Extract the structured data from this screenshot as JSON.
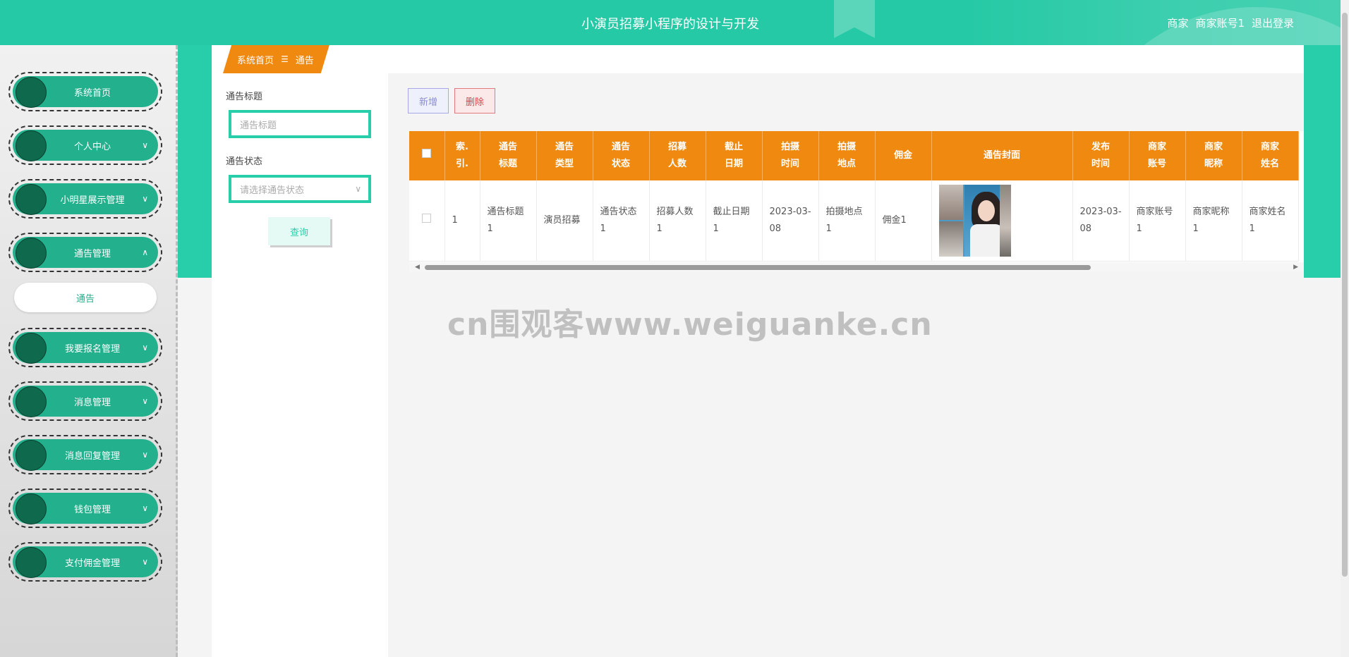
{
  "header": {
    "title": "小演员招募小程序的设计与开发",
    "role": "商家",
    "account": "商家账号1",
    "logout": "退出登录"
  },
  "sidebar": {
    "items": [
      {
        "label": "系统首页",
        "chevron": ""
      },
      {
        "label": "个人中心",
        "chevron": "∨"
      },
      {
        "label": "小明星展示管理",
        "chevron": "∨"
      },
      {
        "label": "通告管理",
        "chevron": "∧"
      },
      {
        "label": "我要报名管理",
        "chevron": "∨"
      },
      {
        "label": "消息管理",
        "chevron": "∨"
      },
      {
        "label": "消息回复管理",
        "chevron": "∨"
      },
      {
        "label": "钱包管理",
        "chevron": "∨"
      },
      {
        "label": "支付佣金管理",
        "chevron": "∨"
      }
    ],
    "active_sub": "通告"
  },
  "breadcrumb": {
    "home": "系统首页",
    "sep": "☰",
    "current": "通告"
  },
  "filter": {
    "title_label": "通告标题",
    "title_placeholder": "通告标题",
    "status_label": "通告状态",
    "status_placeholder": "请选择通告状态",
    "query_btn": "查询"
  },
  "actions": {
    "add": "新增",
    "delete": "删除"
  },
  "table": {
    "headers": [
      "",
      "索引",
      "通告标题",
      "通告类型",
      "通告状态",
      "招募人数",
      "截止日期",
      "拍摄时间",
      "拍摄地点",
      "佣金",
      "通告封面",
      "发布时间",
      "商家账号",
      "商家昵称",
      "商家姓名"
    ],
    "header_lines": [
      [
        "",
        ""
      ],
      [
        "索.",
        "引."
      ],
      [
        "通告",
        "标题"
      ],
      [
        "通告",
        "类型"
      ],
      [
        "通告",
        "状态"
      ],
      [
        "招募",
        "人数"
      ],
      [
        "截止",
        "日期"
      ],
      [
        "拍摄",
        "时间"
      ],
      [
        "拍摄",
        "地点"
      ],
      [
        "佣金",
        ""
      ],
      [
        "通告封面",
        ""
      ],
      [
        "发布",
        "时间"
      ],
      [
        "商家",
        "账号"
      ],
      [
        "商家",
        "昵称"
      ],
      [
        "商家",
        "姓名"
      ]
    ],
    "rows": [
      {
        "index": "1",
        "title": "通告标题1",
        "type": "演员招募",
        "status": "通告状态1",
        "count": "招募人数1",
        "deadline": "截止日期1",
        "shoot_time": "2023-03-08",
        "location": "拍摄地点1",
        "commission": "佣金1",
        "publish_time": "2023-03-08",
        "account": "商家账号1",
        "nickname": "商家昵称1",
        "name": "商家姓名1"
      }
    ]
  },
  "watermark": "cn围观客www.weiguanke.cn",
  "colors": {
    "header": "#25c9a5",
    "sidebar_pill": "#23b08d",
    "sidebar_dot": "#0f6a4d",
    "table_head": "#f0890f",
    "accent": "#28cdaa"
  }
}
